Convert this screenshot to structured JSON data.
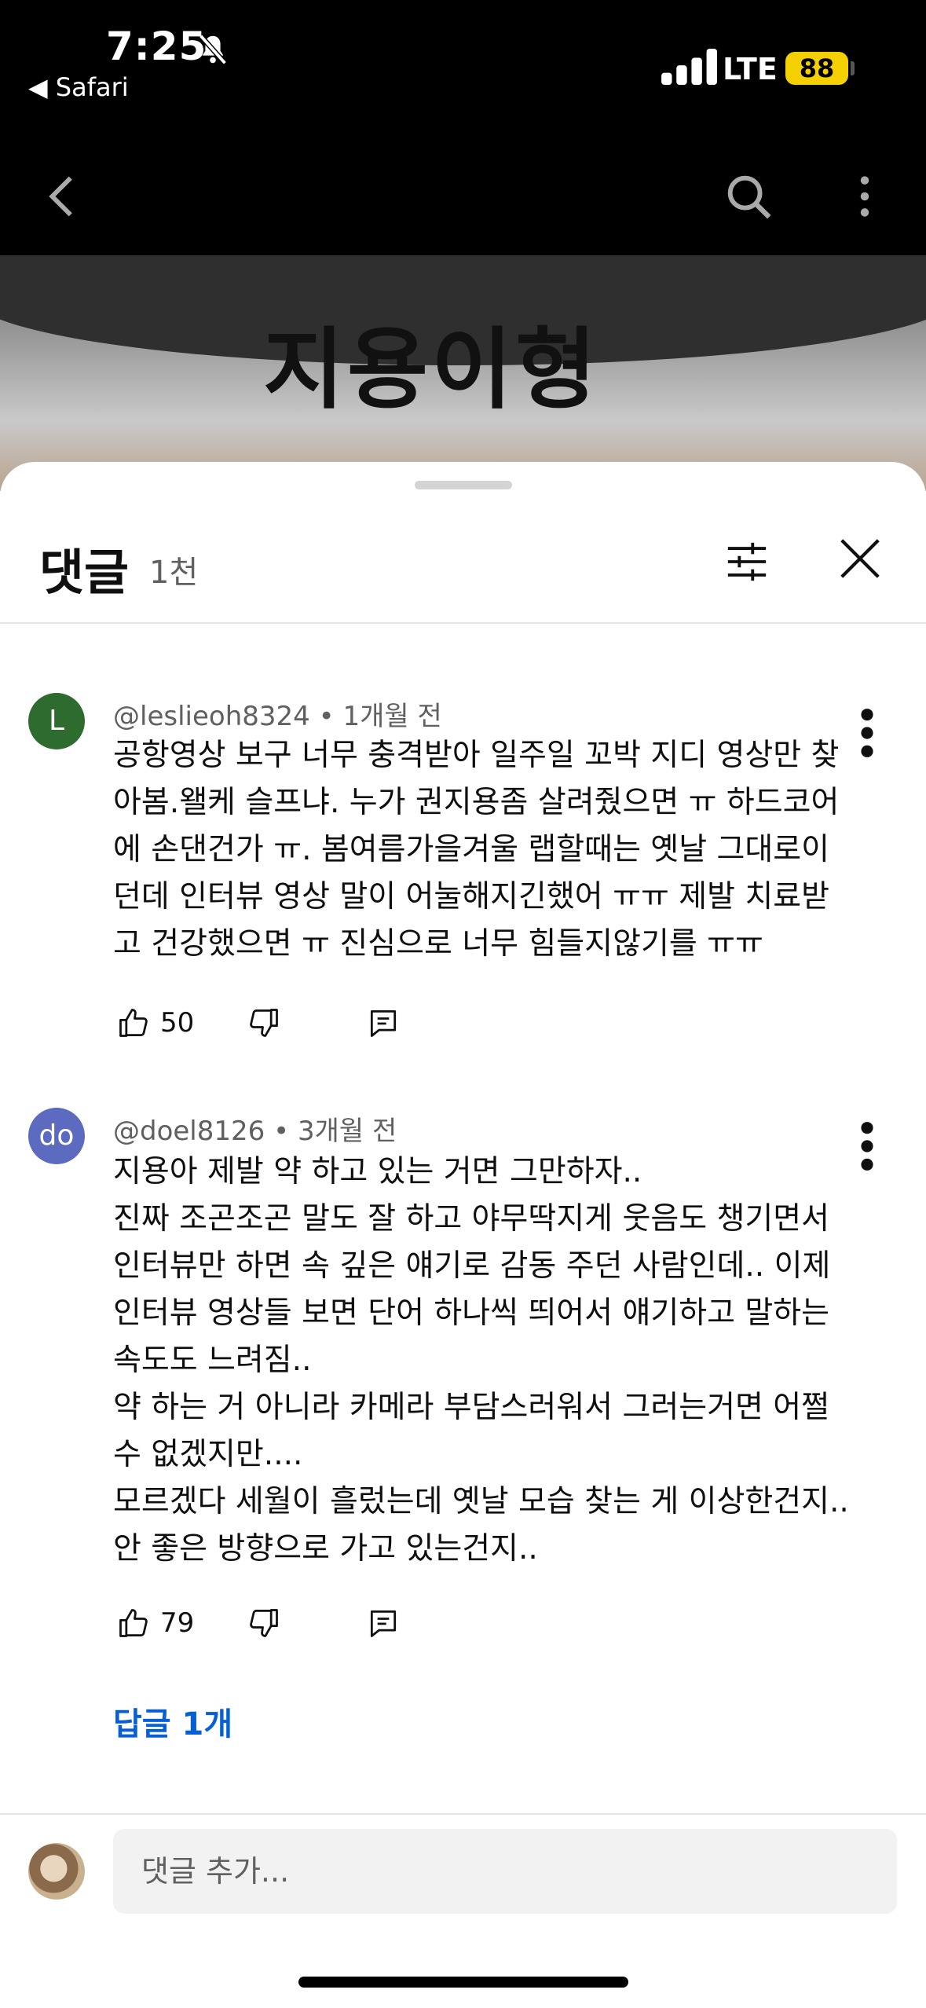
{
  "status_bar": {
    "time": "7:25",
    "back_app": "◀ Safari",
    "network": "LTE",
    "battery": "88"
  },
  "video": {
    "title_text": "지용이형"
  },
  "comments_panel": {
    "title": "댓글",
    "count": "1천",
    "comments": [
      {
        "avatar_letter": "L",
        "avatar_color": "#2e6b2e",
        "author": "@leslieoh8324",
        "time": "• 1개월 전",
        "text": "공항영상 보구 너무  충격받아 일주일 꼬박 지디 영상만 찾\n아봄.왤케 슬프냐. 누가 권지용좀 살려줬으면 ㅠ 하드코어\n에 손댄건가 ㅠ.  봄여름가을겨울  랩할때는 옛날 그대로이\n던데 인터뷰 영상 말이 어눌해지긴했어 ㅠㅠ  제발 치료받\n고 건강했으면 ㅠ 진심으로 너무 힘들지않기를 ㅠㅠ",
        "likes": "50"
      },
      {
        "avatar_letter": "do",
        "avatar_color": "#5c6bc0",
        "author": "@doel8126",
        "time": "• 3개월 전",
        "text": "지용아 제발 약 하고 있는 거면 그만하자..\n진짜 조곤조곤 말도 잘 하고 야무딱지게 웃음도 챙기면서\n인터뷰만 하면 속 깊은 얘기로 감동 주던 사람인데.. 이제\n인터뷰 영상들 보면 단어 하나씩 띄어서 얘기하고 말하는\n속도도 느려짐..\n약 하는 거 아니라 카메라 부담스러워서 그러는거면 어쩔\n수 없겠지만....\n모르겠다 세월이 흘렀는데 옛날 모습 찾는 게 이상한건지..\n안 좋은 방향으로 가고 있는건지..",
        "likes": "79",
        "replies": "답글 1개"
      }
    ],
    "add_comment_placeholder": "댓글 추가..."
  },
  "colors": {
    "accent_link": "#065fd4",
    "battery": "#f5d000"
  }
}
